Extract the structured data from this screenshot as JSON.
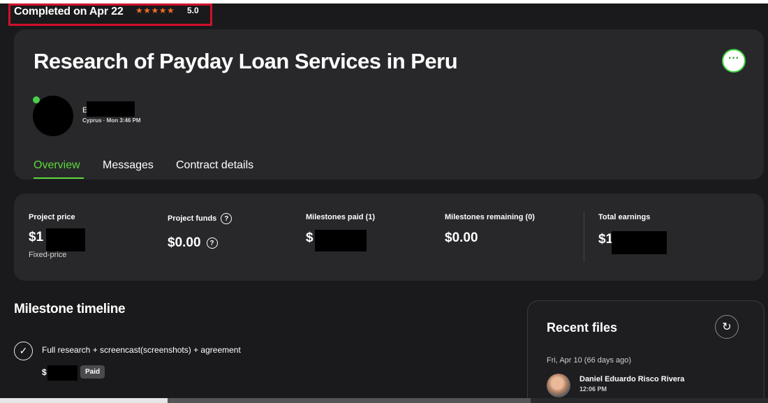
{
  "status": {
    "completed_text": "Completed on Apr 22",
    "stars": "★★★★★",
    "rating": "5.0"
  },
  "project": {
    "title": "Research of Payday Loan Services in Peru",
    "more_label": "···"
  },
  "client": {
    "initial": "E",
    "meta": "Cyprus · Mon 3:46 PM",
    "online": true
  },
  "tabs": [
    {
      "label": "Overview",
      "active": true
    },
    {
      "label": "Messages",
      "active": false
    },
    {
      "label": "Contract details",
      "active": false
    }
  ],
  "stats": {
    "project_price": {
      "label": "Project price",
      "value": "$1",
      "sub": "Fixed-price"
    },
    "project_funds": {
      "label": "Project funds",
      "value": "$0.00"
    },
    "milestones_paid": {
      "label": "Milestones paid (1)",
      "value": "$"
    },
    "milestones_remaining": {
      "label": "Milestones remaining (0)",
      "value": "$0.00"
    },
    "total_earnings": {
      "label": "Total earnings",
      "value": "$1"
    },
    "help_glyph": "?"
  },
  "milestones": {
    "title": "Milestone timeline",
    "items": [
      {
        "label": "Full research + screencast(screenshots) + agreement",
        "amount": "$",
        "badge": "Paid",
        "check": "✓"
      }
    ]
  },
  "recent_files": {
    "title": "Recent files",
    "refresh_glyph": "↻",
    "date": "Fri, Apr 10  (66 days ago)",
    "user": "Daniel Eduardo Risco Rivera",
    "time": "12:06 PM"
  },
  "colors": {
    "accent_green": "#5fd83a",
    "star_orange": "#f26b25",
    "highlight_red": "#d0102b",
    "card_bg": "#28282b",
    "page_bg": "#1a1a1c"
  },
  "icons": [
    "star-icon",
    "more-icon",
    "help-icon",
    "check-icon",
    "refresh-icon"
  ]
}
